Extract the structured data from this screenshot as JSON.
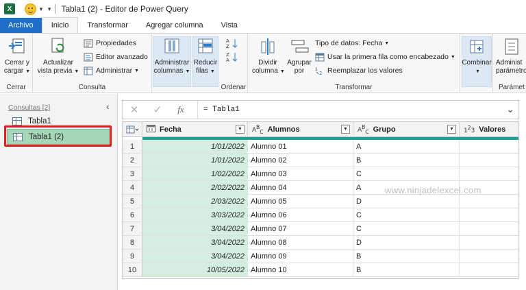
{
  "title_bar": {
    "app_icon": "X",
    "title": "Tabla1 (2) - Editor de Power Query"
  },
  "tabs": [
    {
      "label": "Archivo",
      "kind": "file"
    },
    {
      "label": "Inicio",
      "kind": "active"
    },
    {
      "label": "Transformar",
      "kind": "normal"
    },
    {
      "label": "Agregar columna",
      "kind": "normal"
    },
    {
      "label": "Vista",
      "kind": "normal"
    }
  ],
  "ribbon": {
    "cerrar": {
      "btn1": "Cerrar y",
      "btn2": "cargar",
      "label": "Cerrar"
    },
    "consulta": {
      "btn1": "Actualizar",
      "btn2": "vista previa",
      "propiedades": "Propiedades",
      "editor": "Editor avanzado",
      "administrar": "Administrar",
      "label": "Consulta"
    },
    "ordenar": {
      "adm1": "Administrar",
      "adm2": "columnas",
      "red1": "Reducir",
      "red2": "filas",
      "label": "Ordenar"
    },
    "transformar": {
      "div1": "Dividir",
      "div2": "columna",
      "agr1": "Agrupar",
      "agr2": "por",
      "tipo": "Tipo de datos: Fecha",
      "primera": "Usar la primera fila como encabezado",
      "reemplazar": "Reemplazar los valores",
      "label": "Transformar"
    },
    "combinar": {
      "btn": "Combinar"
    },
    "parametros": {
      "btn1": "Administ",
      "btn2": "parámetro",
      "label": "Parámet"
    }
  },
  "sidebar": {
    "header": "Consultas [2]",
    "items": [
      {
        "label": "Tabla1"
      },
      {
        "label": "Tabla1 (2)"
      }
    ]
  },
  "formula_bar": {
    "formula": "= Tabla1"
  },
  "grid": {
    "columns": [
      {
        "name": "Fecha",
        "type_icon": "date"
      },
      {
        "name": "Alumnos",
        "type_icon": "ABC"
      },
      {
        "name": "Grupo",
        "type_icon": "ABC"
      },
      {
        "name": "Valores",
        "type_icon": "123"
      }
    ],
    "rows": [
      {
        "n": "1",
        "fecha": "1/01/2022",
        "alumno": "Alumno 01",
        "grupo": "A",
        "valor": ""
      },
      {
        "n": "2",
        "fecha": "1/01/2022",
        "alumno": "Alumno 02",
        "grupo": "B",
        "valor": ""
      },
      {
        "n": "3",
        "fecha": "1/02/2022",
        "alumno": "Alumno 03",
        "grupo": "C",
        "valor": ""
      },
      {
        "n": "4",
        "fecha": "2/02/2022",
        "alumno": "Alumno 04",
        "grupo": "A",
        "valor": ""
      },
      {
        "n": "5",
        "fecha": "2/03/2022",
        "alumno": "Alumno 05",
        "grupo": "D",
        "valor": ""
      },
      {
        "n": "6",
        "fecha": "3/03/2022",
        "alumno": "Alumno 06",
        "grupo": "C",
        "valor": ""
      },
      {
        "n": "7",
        "fecha": "3/04/2022",
        "alumno": "Alumno 07",
        "grupo": "C",
        "valor": ""
      },
      {
        "n": "8",
        "fecha": "3/04/2022",
        "alumno": "Alumno 08",
        "grupo": "D",
        "valor": ""
      },
      {
        "n": "9",
        "fecha": "3/04/2022",
        "alumno": "Alumno 09",
        "grupo": "B",
        "valor": ""
      },
      {
        "n": "10",
        "fecha": "10/05/2022",
        "alumno": "Alumno 10",
        "grupo": "B",
        "valor": ""
      }
    ]
  },
  "watermark": "www.ninjadelexcel.com",
  "colors": {
    "file_tab": "#1e6ec8",
    "selected_query": "#a7d7b9",
    "highlight_box": "#e01c1c",
    "quality_bar": "#1fa094",
    "date_column": "#d4efe0"
  }
}
